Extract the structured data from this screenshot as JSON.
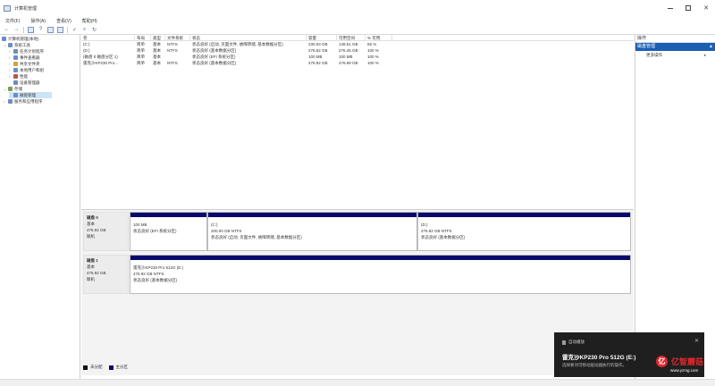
{
  "window": {
    "title": "计算机管理",
    "minimize_label": "",
    "maximize_label": "",
    "close_label": "✕"
  },
  "menu": [
    "文件(F)",
    "操作(A)",
    "查看(V)",
    "帮助(H)"
  ],
  "toolbar_icons": [
    "back-icon",
    "forward-icon",
    "up-folder-icon",
    "properties-icon",
    "help-icon",
    "list-view-icon",
    "check-icon",
    "search-icon",
    "refresh-icon"
  ],
  "tree": {
    "root": "计算机管理(本地)",
    "items": [
      {
        "label": "系统工具",
        "expanded": "⌄"
      },
      {
        "label": "任务计划程序",
        "expanded": "›"
      },
      {
        "label": "事件查看器",
        "expanded": "›"
      },
      {
        "label": "共享文件夹",
        "expanded": "›"
      },
      {
        "label": "本地用户和组",
        "expanded": "›"
      },
      {
        "label": "性能",
        "expanded": "›"
      },
      {
        "label": "设备管理器",
        "expanded": ""
      },
      {
        "label": "存储",
        "expanded": "⌄"
      },
      {
        "label": "磁盘管理",
        "expanded": ""
      },
      {
        "label": "服务和应用程序",
        "expanded": "›"
      }
    ]
  },
  "volumes": {
    "headers": [
      "卷",
      "布局",
      "类型",
      "文件系统",
      "状态",
      "容量",
      "可用空间",
      "% 可用"
    ],
    "rows": [
      [
        "(C:)",
        "简单",
        "基本",
        "NTFS",
        "状态良好 (启动, 页面文件, 故障转储, 基本数据分区)",
        "230.03 GB",
        "149.51 GB",
        "65 %"
      ],
      [
        "(D:)",
        "简单",
        "基本",
        "NTFS",
        "状态良好 (基本数据分区)",
        "276.62 GB",
        "276.45 GB",
        "100 %"
      ],
      [
        "(磁盘 0 磁盘分区 1)",
        "简单",
        "基本",
        "",
        "状态良好 (EFI 系统分区)",
        "100 MB",
        "100 MB",
        "100 %"
      ],
      [
        "雷克沙KP230 Pro...",
        "简单",
        "基本",
        "NTFS",
        "状态良好 (基本数据分区)",
        "476.92 GB",
        "476.69 GB",
        "100 %"
      ]
    ]
  },
  "disks": [
    {
      "name": "磁盘 0",
      "type": "基本",
      "size": "476.92 GB",
      "status": "联机",
      "partitions": [
        {
          "lines": [
            "100 MB",
            "状态良好 (EFI 系统分区)"
          ]
        },
        {
          "lines": [
            "(C:)",
            "200.00 GB NTFS",
            "状态良好 (启动, 页面文件, 故障转储, 基本数据分区)"
          ]
        },
        {
          "lines": [
            "(D:)",
            "276.82 GB NTFS",
            "状态良好 (基本数据分区)"
          ]
        }
      ]
    },
    {
      "name": "磁盘 1",
      "type": "基本",
      "size": "476.92 GB",
      "status": "联机",
      "partitions": [
        {
          "lines": [
            "雷克沙KP230 Pro 512G (E:)",
            "476.92 GB NTFS",
            "状态良好 (基本数据分区)"
          ]
        }
      ]
    }
  ],
  "legend": [
    {
      "label": "未分配",
      "color": "#111111"
    },
    {
      "label": "主分区",
      "color": "#09096b"
    }
  ],
  "actions": {
    "header": "操作",
    "selected": "磁盘管理",
    "selected_caret": "▲",
    "item": "更多操作",
    "item_caret": "▸"
  },
  "toast": {
    "header": "自动播放",
    "title": "雷克沙KP230 Pro 512G (E:)",
    "message": "选择要对可移动驱动器执行的操作。",
    "close": "✕"
  },
  "watermark": {
    "logo": "亿",
    "brand": "亿智蘑菇",
    "url": "www.yzmg.com"
  },
  "colors": {
    "primary_partition": "#09096b",
    "selection": "#1a5fb4",
    "tree_selection": "#cde4f7",
    "toast_bg": "#1f1f1f",
    "brand_red": "#e0282d"
  }
}
